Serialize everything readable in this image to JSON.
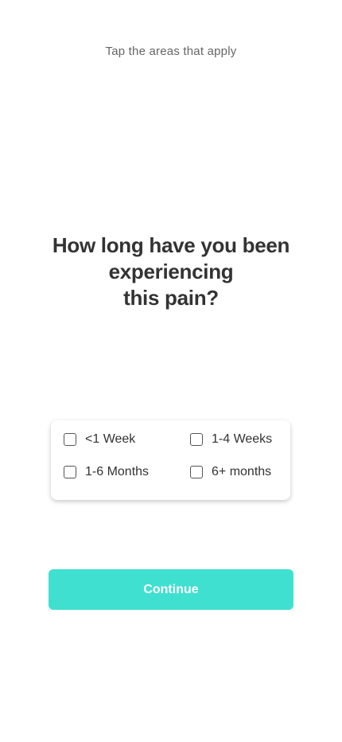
{
  "header": {
    "instruction": "Tap the areas that apply"
  },
  "question": {
    "line1": "How long have you been",
    "line2": "experiencing",
    "line3": "this pain?"
  },
  "options": [
    {
      "label": "<1 Week",
      "checked": false
    },
    {
      "label": "1-4 Weeks",
      "checked": false
    },
    {
      "label": "1-6 Months",
      "checked": false
    },
    {
      "label": "6+ months",
      "checked": false
    }
  ],
  "actions": {
    "continue_label": "Continue",
    "continue_color": "#40e0d0"
  }
}
